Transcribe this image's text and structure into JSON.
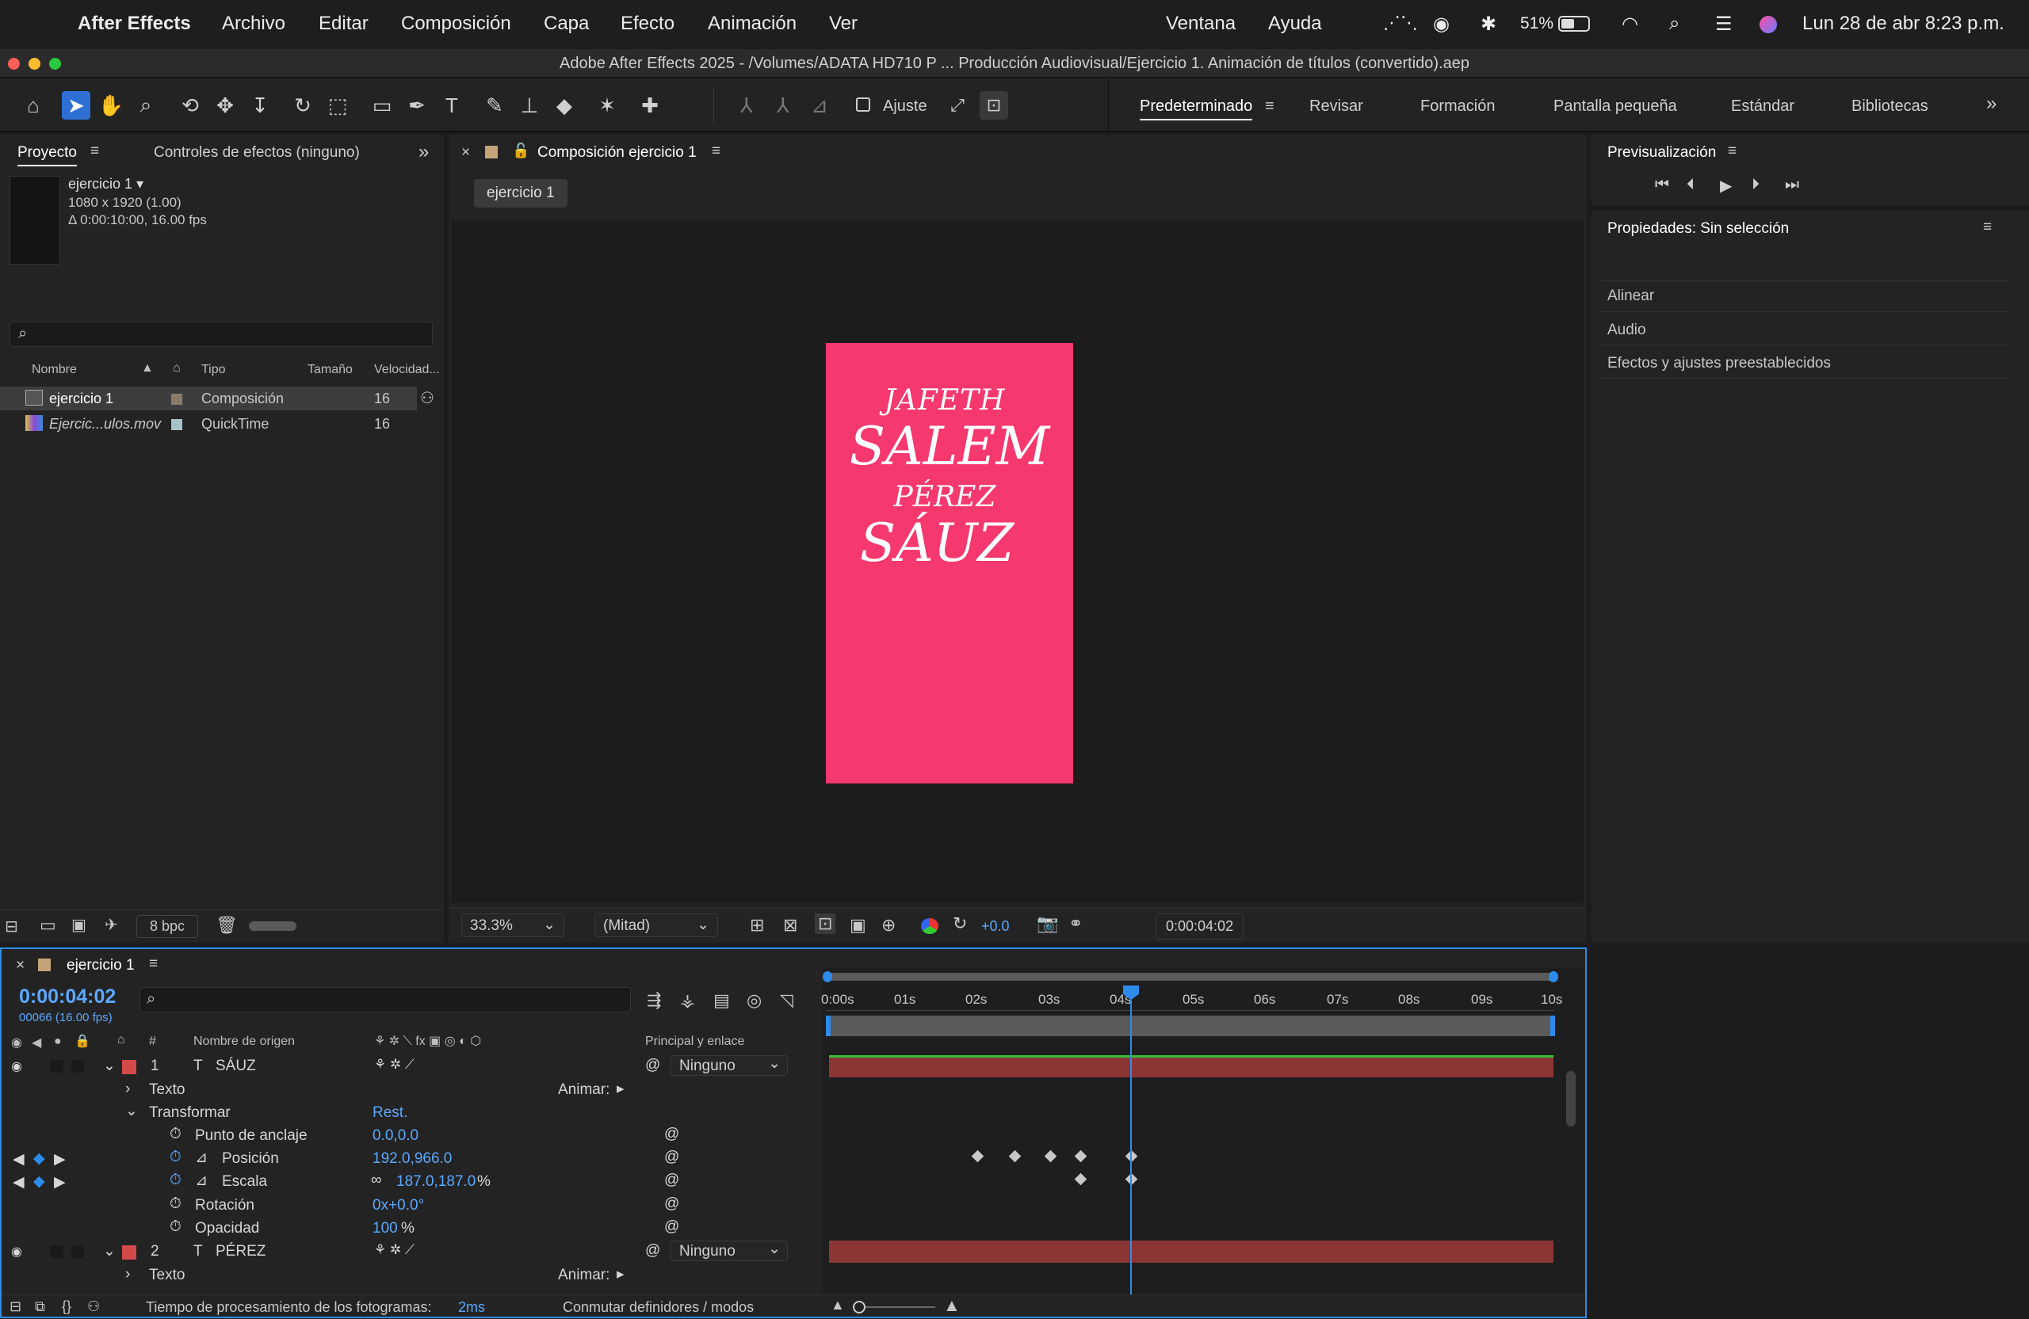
{
  "menubar": {
    "app_name": "After Effects",
    "menus": [
      "Archivo",
      "Editar",
      "Composición",
      "Capa",
      "Efecto",
      "Animación",
      "Ver",
      "Ventana",
      "Ayuda"
    ],
    "battery": "51%",
    "datetime": "Lun 28 de abr  8:23 p.m."
  },
  "window": {
    "title": "Adobe After Effects 2025 - /Volumes/ADATA HD710 P ... Producción Audiovisual/Ejercicio 1. Animación de títulos (convertido).aep"
  },
  "toolbar": {
    "snap_label": "Ajuste",
    "workspaces": [
      "Predeterminado",
      "Revisar",
      "Formación",
      "Pantalla pequeña",
      "Estándar",
      "Bibliotecas"
    ],
    "active_workspace": "Predeterminado"
  },
  "project_panel": {
    "tab_project": "Proyecto",
    "tab_effects": "Controles de efectos (ninguno)",
    "selected_name": "ejercicio 1 ▾",
    "selected_res": "1080 x 1920 (1.00)",
    "selected_dur": "Δ 0:00:10:00, 16.00 fps",
    "search_placeholder": "",
    "columns": {
      "name": "Nombre",
      "type": "Tipo",
      "size": "Tamaño",
      "speed": "Velocidad..."
    },
    "items": [
      {
        "name": "ejercicio 1",
        "type": "Composición",
        "speed": "16"
      },
      {
        "name": "Ejercic...ulos.mov",
        "type": "QuickTime",
        "speed": "16"
      }
    ],
    "bpc": "8 bpc"
  },
  "composition_panel": {
    "tab": "Composición ejercicio 1",
    "breadcrumb": "ejercicio 1",
    "zoom": "33.3%",
    "resolution": "(Mitad)",
    "exposure": "+0.0",
    "timecode": "0:00:04:02",
    "title_lines": [
      "JAFETH",
      "SALEM",
      "PÉREZ",
      "SÁUZ"
    ],
    "canvas_color": "#f5386e"
  },
  "right_panels": {
    "preview_title": "Previsualización",
    "properties_title": "Propiedades: Sin selección",
    "sections": [
      "Alinear",
      "Audio",
      "Efectos y ajustes preestablecidos"
    ]
  },
  "timeline": {
    "tab": "ejercicio 1",
    "current_time": "0:00:04:02",
    "frame_info": "00066 (16.00 fps)",
    "col_source_name": "Nombre de origen",
    "col_parent": "Principal y enlace",
    "ruler": [
      "0:00s",
      "01s",
      "02s",
      "03s",
      "04s",
      "05s",
      "06s",
      "07s",
      "08s",
      "09s",
      "10s"
    ],
    "layers": [
      {
        "num": "1",
        "name": "SÁUZ",
        "parent": "Ninguno"
      },
      {
        "num": "2",
        "name": "PÉREZ",
        "parent": "Ninguno"
      }
    ],
    "text_label": "Texto",
    "animate_label": "Animar:",
    "transform_label": "Transformar",
    "reset_label": "Rest.",
    "props": [
      {
        "name": "Punto de anclaje",
        "value": "0.0,0.0"
      },
      {
        "name": "Posición",
        "value": "192.0,966.0"
      },
      {
        "name": "Escala",
        "value": "187.0,187.0",
        "unit": "%"
      },
      {
        "name": "Rotación",
        "value": "0x+0.0°"
      },
      {
        "name": "Opacidad",
        "value": "100",
        "unit": "%"
      }
    ],
    "footer_label": "Tiempo de procesamiento de los fotogramas:",
    "footer_value": "2ms",
    "toggle_label": "Conmutar definidores / modos"
  },
  "colors": {
    "accent": "#2d8ceb",
    "layer_bar": "#8b3535",
    "workarea": "#5a5a5a"
  }
}
